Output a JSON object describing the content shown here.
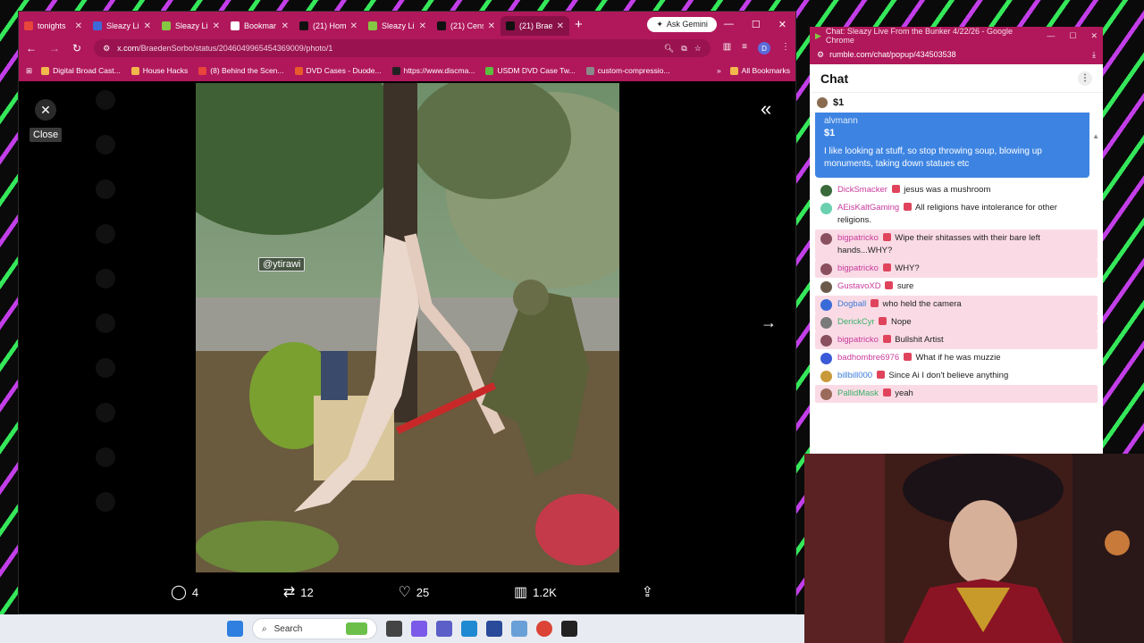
{
  "browser": {
    "tabs": [
      {
        "label": "tonights",
        "color": "#e8453c",
        "active": false
      },
      {
        "label": "Sleazy Li",
        "color": "#3d6ad6",
        "active": false
      },
      {
        "label": "Sleazy Li",
        "color": "#85c742",
        "active": false
      },
      {
        "label": "Bookmar",
        "color": "#ffffff",
        "active": false
      },
      {
        "label": "(21) Hom",
        "color": "#111111",
        "active": false
      },
      {
        "label": "Sleazy Li",
        "color": "#85c742",
        "active": false
      },
      {
        "label": "(21) Cens",
        "color": "#111111",
        "active": false
      },
      {
        "label": "(21) Brae",
        "color": "#111111",
        "active": true
      }
    ],
    "ask_gemini": "Ask Gemini",
    "url_host": "x.com",
    "url_path": "/BraedenSorbo/status/2046049965454369009/photo/1",
    "bookmarks": [
      {
        "label": "Digital Broad Cast...",
        "color": "#f2b84b"
      },
      {
        "label": "House Hacks",
        "color": "#f2b84b"
      },
      {
        "label": "(8) Behind the Scen...",
        "color": "#e8453c"
      },
      {
        "label": "DVD Cases - Duode...",
        "color": "#e85a2c"
      },
      {
        "label": "https://www.discma...",
        "color": "#222222"
      },
      {
        "label": "USDM DVD Case Tw...",
        "color": "#5bbf3e"
      },
      {
        "label": "custom-compressio...",
        "color": "#8a8a8a"
      }
    ],
    "all_bookmarks": "All Bookmarks",
    "avatar_letter": "D"
  },
  "viewer": {
    "close_tooltip": "Close",
    "watermark": "@ytirawi",
    "replies": "4",
    "reposts": "12",
    "likes": "25",
    "views": "1.2K"
  },
  "chat": {
    "window_title": "Chat: Sleazy Live From the Bunker 4/22/26 - Google Chrome",
    "url": "rumble.com/chat/popup/434503538",
    "heading": "Chat",
    "tip_amount": "$1",
    "highlight": {
      "user": "alvmann",
      "amount": "$1",
      "text": "I like looking at stuff, so stop throwing soup, blowing up monuments, taking down statues etc"
    },
    "messages": [
      {
        "user": "DickSmacker",
        "color": "#c83a9c",
        "text": "jesus was a mushroom",
        "pink": false,
        "avatar": "#3a6a3a"
      },
      {
        "user": "AEisKaltGaming",
        "color": "#c83a9c",
        "text": "All religions have intolerance for other religions.",
        "pink": false,
        "avatar": "#6ad0b0"
      },
      {
        "user": "bigpatricko",
        "color": "#c83a9c",
        "text": "Wipe their shitasses with their bare left hands...WHY?",
        "pink": true,
        "avatar": "#8a5060"
      },
      {
        "user": "bigpatricko",
        "color": "#c83a9c",
        "text": "WHY?",
        "pink": true,
        "avatar": "#8a5060"
      },
      {
        "user": "GustavoXD",
        "color": "#c83a9c",
        "text": "sure",
        "pink": false,
        "avatar": "#6b5a4a"
      },
      {
        "user": "Dogball",
        "color": "#3a7ad8",
        "text": "who held the camera",
        "pink": true,
        "avatar": "#3a6ad8"
      },
      {
        "user": "DerickCyr",
        "color": "#3ab06a",
        "text": "Nope",
        "pink": true,
        "avatar": "#7a7a7a"
      },
      {
        "user": "bigpatricko",
        "color": "#c83a9c",
        "text": "Bullshit Artist",
        "pink": true,
        "avatar": "#8a5060"
      },
      {
        "user": "badhombre6976",
        "color": "#c83a9c",
        "text": "What if he was muzzie",
        "pink": false,
        "avatar": "#3a5ad8"
      },
      {
        "user": "billbill000",
        "color": "#3a7ad8",
        "text": "Since Ai I don't believe anything",
        "pink": false,
        "avatar": "#c89a3a"
      },
      {
        "user": "PallidMask",
        "color": "#3ab06a",
        "text": "yeah",
        "pink": true,
        "avatar": "#9a6a5a"
      }
    ]
  },
  "taskbar": {
    "search": "Search"
  }
}
